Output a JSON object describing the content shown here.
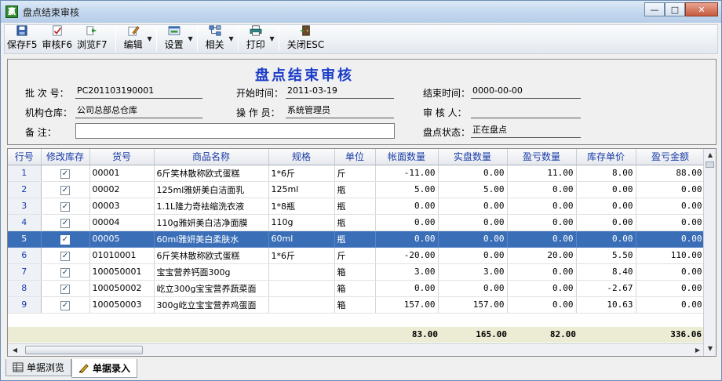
{
  "window": {
    "title": "盘点结束审核",
    "app_icon_text": "赢",
    "btn_minimize": "—",
    "btn_maximize": "□",
    "btn_close": "✕"
  },
  "toolbar": {
    "save": "保存F5",
    "audit": "审核F6",
    "browse": "浏览F7",
    "edit": "编辑",
    "settings": "设置",
    "related": "相关",
    "print": "打印",
    "close": "关闭ESC",
    "dropdown_arrow": "▼"
  },
  "form": {
    "title": "盘点结束审核",
    "batch_label": "批 次 号：",
    "batch_value": "PC201103190001",
    "start_label": "开始时间：",
    "start_value": "2011-03-19",
    "end_label": "结束时间：",
    "end_value": "0000-00-00",
    "warehouse_label": "机构仓库：",
    "warehouse_value": "公司总部总仓库",
    "operator_label": "操 作 员：",
    "operator_value": "系统管理员",
    "auditor_label": "审 核 人：",
    "auditor_value": "",
    "note_label": "备    注：",
    "note_value": "",
    "status_label": "盘点状态：",
    "status_value": "正在盘点"
  },
  "grid": {
    "columns": [
      "行号",
      "修改库存",
      "货号",
      "商品名称",
      "规格",
      "单位",
      "帐面数量",
      "实盘数量",
      "盈亏数量",
      "库存单价",
      "盈亏金额"
    ],
    "selected_row": 4,
    "check_mark": "✓",
    "rows": [
      {
        "no": "1",
        "code": "00001",
        "name": "6斤笑林散称欧式蛋糕",
        "spec": "1*6斤",
        "unit": "斤",
        "book": "-11.00",
        "actual": "0.00",
        "diff": "11.00",
        "price": "8.00",
        "amount": "88.00"
      },
      {
        "no": "2",
        "code": "00002",
        "name": "125ml雅妍美白洁面乳",
        "spec": "125ml",
        "unit": "瓶",
        "book": "5.00",
        "actual": "5.00",
        "diff": "0.00",
        "price": "0.00",
        "amount": "0.00"
      },
      {
        "no": "3",
        "code": "00003",
        "name": "1.1L隆力奇袪缩洗衣液",
        "spec": "1*8瓶",
        "unit": "瓶",
        "book": "0.00",
        "actual": "0.00",
        "diff": "0.00",
        "price": "0.00",
        "amount": "0.00"
      },
      {
        "no": "4",
        "code": "00004",
        "name": "110g雅妍美白洁净面膜",
        "spec": "110g",
        "unit": "瓶",
        "book": "0.00",
        "actual": "0.00",
        "diff": "0.00",
        "price": "0.00",
        "amount": "0.00"
      },
      {
        "no": "5",
        "code": "00005",
        "name": "60ml雅妍美白柔肤水",
        "spec": "60ml",
        "unit": "瓶",
        "book": "0.00",
        "actual": "0.00",
        "diff": "0.00",
        "price": "0.00",
        "amount": "0.00"
      },
      {
        "no": "6",
        "code": "01010001",
        "name": "6斤笑林散称欧式蛋糕",
        "spec": "1*6斤",
        "unit": "斤",
        "book": "-20.00",
        "actual": "0.00",
        "diff": "20.00",
        "price": "5.50",
        "amount": "110.00"
      },
      {
        "no": "7",
        "code": "100050001",
        "name": "宝宝营养钙面300g",
        "spec": "",
        "unit": "箱",
        "book": "3.00",
        "actual": "3.00",
        "diff": "0.00",
        "price": "8.40",
        "amount": "0.00"
      },
      {
        "no": "8",
        "code": "100050002",
        "name": "屹立300g宝宝营养蔬菜面",
        "spec": "",
        "unit": "箱",
        "book": "0.00",
        "actual": "0.00",
        "diff": "0.00",
        "price": "-2.67",
        "amount": "0.00"
      },
      {
        "no": "9",
        "code": "100050003",
        "name": "300g屹立宝宝营养鸡蛋面",
        "spec": "",
        "unit": "箱",
        "book": "157.00",
        "actual": "157.00",
        "diff": "0.00",
        "price": "10.63",
        "amount": "0.00"
      }
    ],
    "totals": {
      "book": "83.00",
      "actual": "165.00",
      "diff": "82.00",
      "amount": "336.06"
    }
  },
  "tabs": {
    "browse": "单据浏览",
    "entry": "单据录入"
  }
}
